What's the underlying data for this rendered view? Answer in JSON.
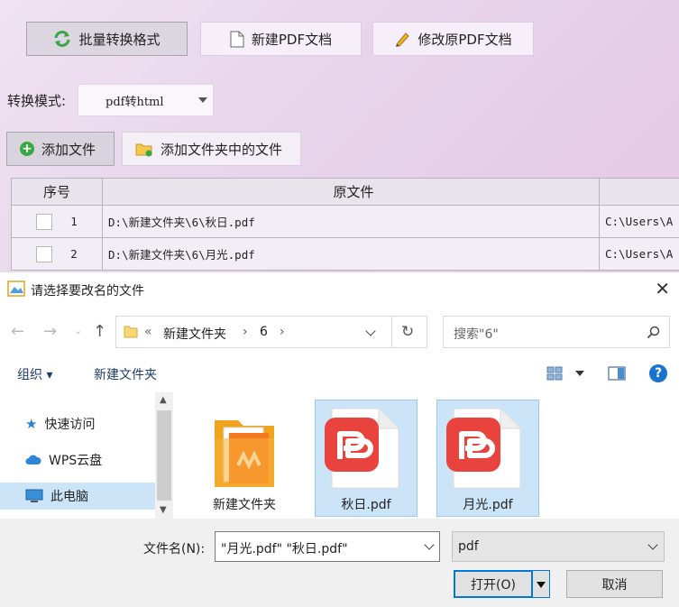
{
  "app": {
    "toolbar": {
      "batch_convert": "批量转换格式",
      "new_pdf": "新建PDF文档",
      "modify_pdf": "修改原PDF文档"
    },
    "mode": {
      "label": "转换模式:",
      "value": "pdf转html"
    },
    "add_file": "添加文件",
    "add_folder_files": "添加文件夹中的文件",
    "table": {
      "headers": [
        "序号",
        "原文件"
      ],
      "rows": [
        {
          "index": "1",
          "source": "D:\\新建文件夹\\6\\秋日.pdf",
          "output": "C:\\Users\\A"
        },
        {
          "index": "2",
          "source": "D:\\新建文件夹\\6\\月光.pdf",
          "output": "C:\\Users\\A"
        }
      ]
    }
  },
  "dialog": {
    "title": "请选择要改名的文件",
    "breadcrumb": {
      "prefix": "«",
      "folder": "新建文件夹",
      "sub": "6"
    },
    "search_placeholder": "搜索\"6\"",
    "organize": "组织 ▾",
    "new_folder": "新建文件夹",
    "nav": [
      {
        "label": "快速访问",
        "icon": "star-icon"
      },
      {
        "label": "WPS云盘",
        "icon": "cloud-icon"
      },
      {
        "label": "此电脑",
        "icon": "computer-icon"
      }
    ],
    "files": [
      {
        "name": "新建文件夹",
        "type": "folder",
        "selected": false
      },
      {
        "name": "秋日.pdf",
        "type": "pdf",
        "selected": true
      },
      {
        "name": "月光.pdf",
        "type": "pdf",
        "selected": true
      }
    ],
    "filename_label": "文件名(N):",
    "filename_value": "\"月光.pdf\" \"秋日.pdf\"",
    "filetype_value": "pdf",
    "open_label": "打开(O)",
    "cancel_label": "取消",
    "colors": {
      "selection": "#cce4f7",
      "pdf_red": "#e8433d",
      "accent": "#0078d7"
    }
  }
}
